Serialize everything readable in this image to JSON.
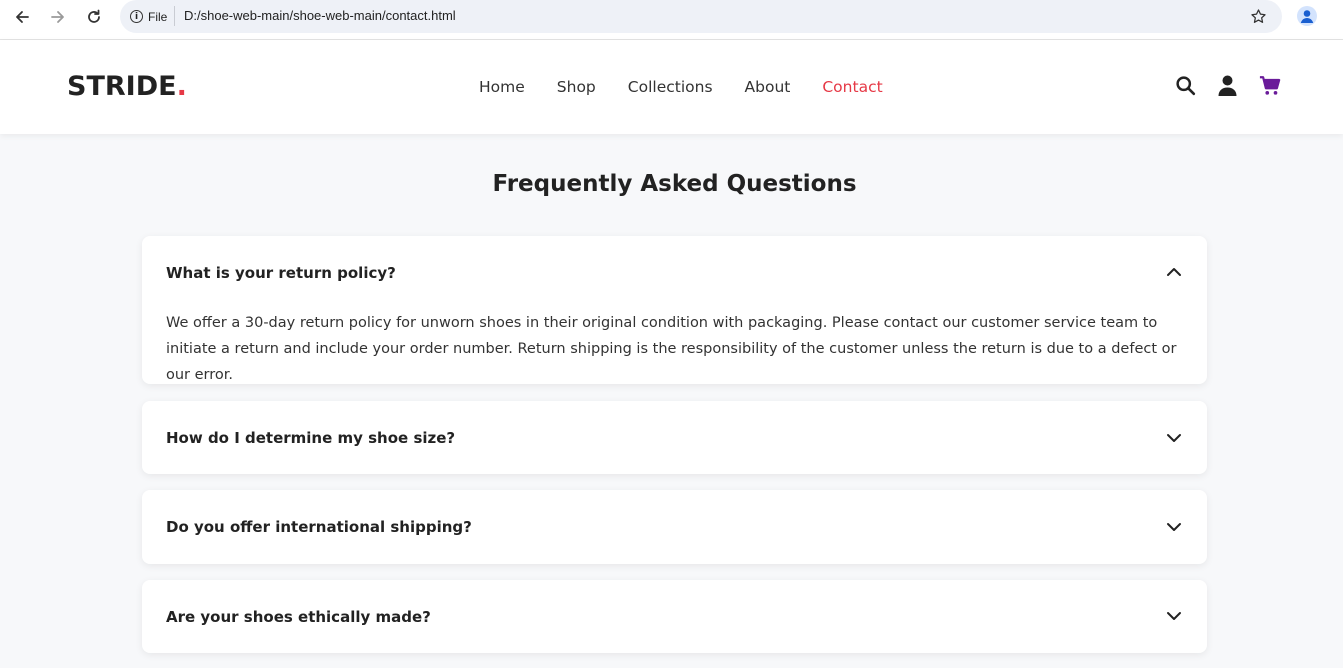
{
  "browser": {
    "site_info_label": "File",
    "url": "D:/shoe-web-main/shoe-web-main/contact.html"
  },
  "site": {
    "logo_text": "STRIDE",
    "logo_dot": ".",
    "nav": [
      {
        "label": "Home"
      },
      {
        "label": "Shop"
      },
      {
        "label": "Collections"
      },
      {
        "label": "About"
      },
      {
        "label": "Contact"
      }
    ],
    "active_nav": "Contact",
    "accent_color": "#e63946",
    "cart_color": "#6a1b9a"
  },
  "faq": {
    "title": "Frequently Asked Questions",
    "items": [
      {
        "question": "What is your return policy?",
        "answer": "We offer a 30-day return policy for unworn shoes in their original condition with packaging. Please contact our customer service team to initiate a return and include your order number. Return shipping is the responsibility of the customer unless the return is due to a defect or our error.",
        "expanded": true
      },
      {
        "question": "How do I determine my shoe size?",
        "expanded": false
      },
      {
        "question": "Do you offer international shipping?",
        "expanded": false
      },
      {
        "question": "Are your shoes ethically made?",
        "expanded": false
      }
    ]
  }
}
